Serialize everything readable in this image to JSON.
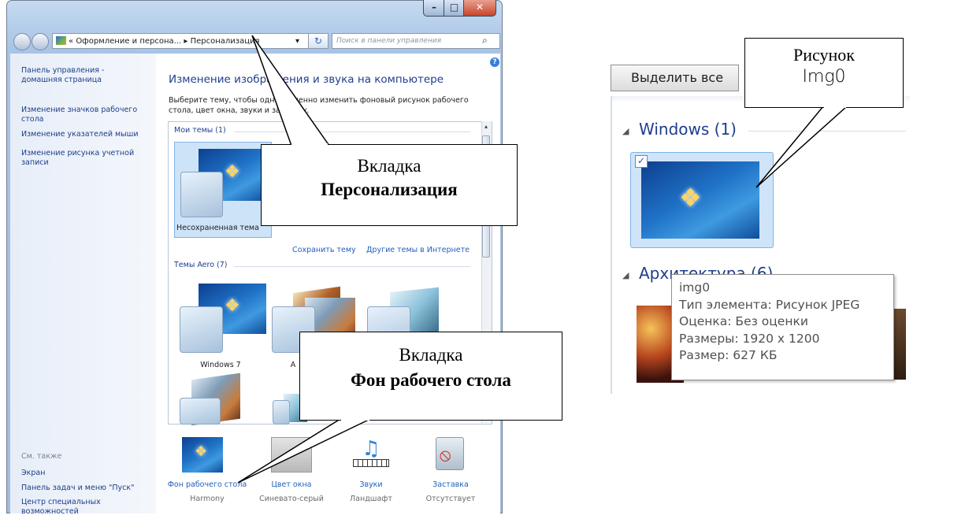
{
  "window": {
    "address": {
      "prefix": "«",
      "crumb1": "Оформление и персона...",
      "separator": "▸",
      "crumb2": "Персонализация"
    },
    "search_placeholder": "Поиск в панели управления",
    "help_label": "?"
  },
  "sidebar": {
    "items": [
      "Панель управления - домашняя страница",
      "Изменение значков рабочего стола",
      "Изменение указателей мыши",
      "Изменение рисунка учетной записи"
    ],
    "see_also_title": "См. также",
    "see_also": [
      "Экран",
      "Панель задач и меню \"Пуск\"",
      "Центр специальных возможностей"
    ]
  },
  "main": {
    "title": "Изменение изображения и звука на компьютере",
    "subtitle": "Выберите тему, чтобы одновременно изменить фоновый рисунок рабочего стола, цвет окна, звуки и заставку.",
    "my_themes_group": "Мои темы (1)",
    "unsaved_theme": "Несохраненная тема",
    "save_theme_link": "Сохранить тему",
    "more_themes_link": "Другие темы в Интернете",
    "aero_group": "Темы Aero (7)",
    "aero_themes": [
      "Windows 7",
      "А"
    ]
  },
  "bottom": [
    {
      "label": "Фон рабочего стола",
      "sub": "Harmony",
      "icon": "desktop-background-icon"
    },
    {
      "label": "Цвет окна",
      "sub": "Синевато-серый",
      "icon": "window-color-icon"
    },
    {
      "label": "Звуки",
      "sub": "Ландшафт",
      "icon": "sounds-icon"
    },
    {
      "label": "Заставка",
      "sub": "Отсутствует",
      "icon": "screensaver-icon"
    }
  ],
  "callouts": {
    "personalization": {
      "line1": "Вкладка",
      "line2": "Персонализация"
    },
    "desktop_bg": {
      "line1": "Вкладка",
      "line2": "Фон рабочего стола"
    },
    "picture": {
      "line1": "Рисунок",
      "line2": "Img0"
    }
  },
  "right_panel": {
    "select_all": "Выделить все",
    "group_windows": "Windows (1)",
    "group_arch": "Архитектура (6)",
    "tooltip": [
      "img0",
      "Тип элемента: Рисунок JPEG",
      "Оценка: Без оценки",
      "Размеры: 1920 x 1200",
      "Размер: 627 КБ"
    ]
  },
  "colors": {
    "link": "#1f5fbf",
    "heading": "#1e3e8d",
    "close_button": "#c7442a"
  }
}
